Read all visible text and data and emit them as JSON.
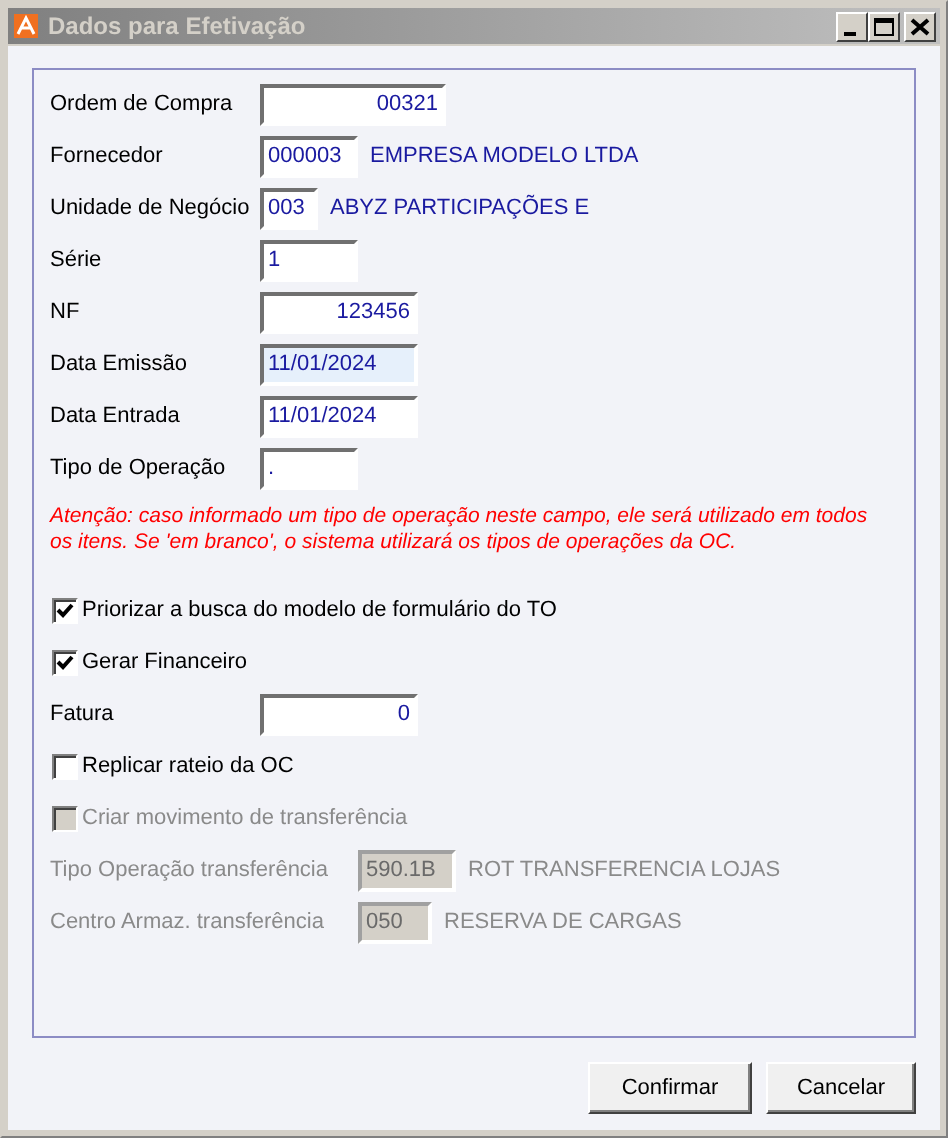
{
  "window": {
    "title": "Dados para Efetivação"
  },
  "form": [
    {
      "kind": "field",
      "label": "Ordem de Compra",
      "value": "00321",
      "right_aligned": true
    },
    {
      "kind": "field",
      "label": "Fornecedor",
      "value": "000003",
      "right_aligned": false,
      "description": "EMPRESA MODELO LTDA"
    },
    {
      "kind": "field",
      "label": "Unidade de Negócio",
      "value": "003",
      "right_aligned": false,
      "description": "ABYZ PARTICIPAÇÕES E"
    },
    {
      "kind": "field",
      "label": "Série",
      "value": "1",
      "right_aligned": false
    },
    {
      "kind": "field",
      "label": "NF",
      "value": "123456",
      "right_aligned": true
    },
    {
      "kind": "field",
      "label": "Data Emissão",
      "value": "11/01/2024",
      "right_aligned": false,
      "focused": true
    },
    {
      "kind": "field",
      "label": "Data Entrada",
      "value": "11/01/2024",
      "right_aligned": false,
      "focused": false
    },
    {
      "kind": "field",
      "label": "Tipo de Operação",
      "value": ".",
      "right_aligned": false
    },
    {
      "kind": "note",
      "text": "Atenção: caso informado um tipo de operação neste campo, ele será utilizado em todos os itens. Se 'em branco', o sistema utilizará os tipos de operações da OC."
    },
    {
      "kind": "check",
      "label": "Priorizar a busca do modelo de formulário do TO",
      "checked": true,
      "disabled": false
    },
    {
      "kind": "check",
      "label": "Gerar Financeiro",
      "checked": true,
      "disabled": false
    },
    {
      "kind": "field",
      "label": "Fatura",
      "value": "0",
      "right_aligned": true
    },
    {
      "kind": "check",
      "label": "Replicar rateio da OC",
      "checked": false,
      "disabled": false
    },
    {
      "kind": "check",
      "label": "Criar movimento de transferência",
      "checked": false,
      "disabled": true
    },
    {
      "kind": "field",
      "label": "Tipo Operação transferência",
      "value": "590.1B",
      "right_aligned": false,
      "disabled": true,
      "description": "ROT TRANSFERENCIA LOJAS"
    },
    {
      "kind": "field",
      "label": "Centro Armaz. transferência",
      "value": "050",
      "right_aligned": false,
      "disabled": true,
      "description": "RESERVA DE CARGAS"
    }
  ],
  "buttons": [
    "Confirmar",
    "Cancelar"
  ]
}
